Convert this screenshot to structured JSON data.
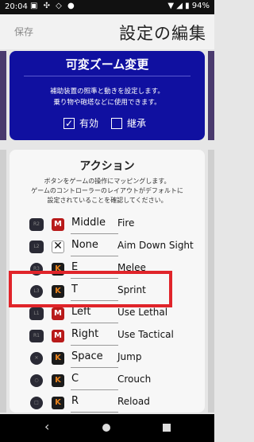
{
  "statusbar": {
    "time": "20:04",
    "battery": "94%"
  },
  "header": {
    "save_label": "保存",
    "title": "設定の編集"
  },
  "zoom": {
    "title": "可変ズーム変更",
    "desc_line1": "補助装置の照準と動きを設定します。",
    "desc_line2": "乗り物や砲塔などに使用できます。",
    "enabled_label": "有効",
    "enabled_checked": true,
    "inherit_label": "継承",
    "inherit_checked": false
  },
  "actions": {
    "title": "アクション",
    "desc_line1": "ボタンをゲームの操作にマッピングします。",
    "desc_line2": "ゲームのコントローラーのレイアウトがデフォルトに",
    "desc_line3": "設定されていることを確認してください。",
    "rows": [
      {
        "pad": "R2",
        "type": "M",
        "key": "Middle",
        "action": "Fire"
      },
      {
        "pad": "L2",
        "type": "✕",
        "key": "None",
        "action": "Aim Down Sight"
      },
      {
        "pad": "R3",
        "type": "K",
        "key": "E",
        "action": "Melee"
      },
      {
        "pad": "L3",
        "type": "K",
        "key": "T",
        "action": "Sprint"
      },
      {
        "pad": "L1",
        "type": "M",
        "key": "Left",
        "action": "Use Lethal"
      },
      {
        "pad": "R1",
        "type": "M",
        "key": "Right",
        "action": "Use Tactical"
      },
      {
        "pad": "✕",
        "type": "K",
        "key": "Space",
        "action": "Jump"
      },
      {
        "pad": "○",
        "type": "K",
        "key": "C",
        "action": "Crouch"
      },
      {
        "pad": "□",
        "type": "K",
        "key": "R",
        "action": "Reload"
      }
    ]
  },
  "colors": {
    "accent": "#1010a0",
    "highlight": "#e0242a",
    "mouse_key": "#b81a1a",
    "keyboard_key": "#e7821c"
  }
}
